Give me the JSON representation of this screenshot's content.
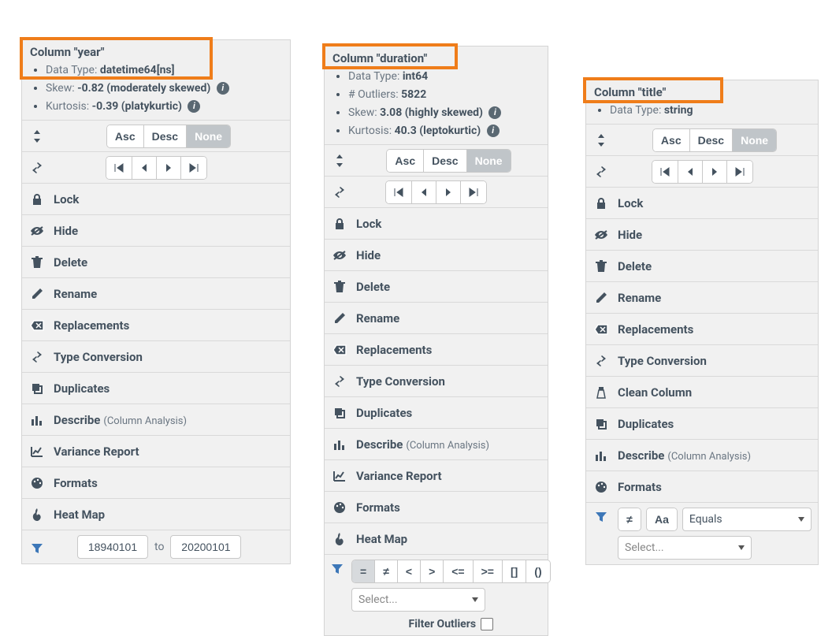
{
  "panels": [
    {
      "id": "year",
      "title": "Column \"year\"",
      "stats": {
        "data_type_label": "Data Type:",
        "data_type": "datetime64[ns]",
        "skew_label": "Skew:",
        "skew": "-0.82 (moderately skewed)",
        "kurt_label": "Kurtosis:",
        "kurt": "-0.39 (platykurtic)"
      },
      "sort": {
        "asc": "Asc",
        "desc": "Desc",
        "none": "None"
      },
      "menu": {
        "lock": "Lock",
        "hide": "Hide",
        "delete": "Delete",
        "rename": "Rename",
        "replacements": "Replacements",
        "typeconv": "Type Conversion",
        "duplicates": "Duplicates",
        "describe": "Describe",
        "describe_sub": "(Column Analysis)",
        "variance": "Variance Report",
        "formats": "Formats",
        "heatmap": "Heat Map"
      },
      "filter": {
        "from": "18940101",
        "to_label": "to",
        "to": "20200101"
      }
    },
    {
      "id": "duration",
      "title": "Column \"duration\"",
      "stats": {
        "data_type_label": "Data Type:",
        "data_type": "int64",
        "outliers_label": "# Outliers:",
        "outliers": "5822",
        "skew_label": "Skew:",
        "skew": "3.08 (highly skewed)",
        "kurt_label": "Kurtosis:",
        "kurt": "40.3 (leptokurtic)"
      },
      "sort": {
        "asc": "Asc",
        "desc": "Desc",
        "none": "None"
      },
      "menu": {
        "lock": "Lock",
        "hide": "Hide",
        "delete": "Delete",
        "rename": "Rename",
        "replacements": "Replacements",
        "typeconv": "Type Conversion",
        "duplicates": "Duplicates",
        "describe": "Describe",
        "describe_sub": "(Column Analysis)",
        "variance": "Variance Report",
        "formats": "Formats",
        "heatmap": "Heat Map"
      },
      "filter": {
        "ops": {
          "eq": "=",
          "ne": "≠",
          "lt": "<",
          "gt": ">",
          "le": "<=",
          "ge": ">=",
          "in": "[]",
          "paren": "()"
        },
        "select": "Select...",
        "outliers_label": "Filter Outliers"
      }
    },
    {
      "id": "title",
      "title": "Column \"title\"",
      "stats": {
        "data_type_label": "Data Type:",
        "data_type": "string"
      },
      "sort": {
        "asc": "Asc",
        "desc": "Desc",
        "none": "None"
      },
      "menu": {
        "lock": "Lock",
        "hide": "Hide",
        "delete": "Delete",
        "rename": "Rename",
        "replacements": "Replacements",
        "typeconv": "Type Conversion",
        "clean": "Clean Column",
        "duplicates": "Duplicates",
        "describe": "Describe",
        "describe_sub": "(Column Analysis)",
        "formats": "Formats"
      },
      "filter": {
        "ne": "≠",
        "case": "Aa",
        "mode": "Equals",
        "select": "Select..."
      }
    }
  ]
}
